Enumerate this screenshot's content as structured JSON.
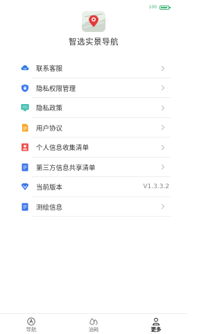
{
  "status_bar": {
    "battery_label": "100"
  },
  "app": {
    "title": "智选实景导航"
  },
  "menu": [
    {
      "label": "联系客服",
      "icon": "cloud-service-icon",
      "color": "#2f7be8"
    },
    {
      "label": "隐私权限管理",
      "icon": "shield-icon",
      "color": "#3b7cf0"
    },
    {
      "label": "隐私政策",
      "icon": "monitor-icon",
      "color": "#2bb6a6"
    },
    {
      "label": "用户协议",
      "icon": "document-icon",
      "color": "#f5a623"
    },
    {
      "label": "个人信息收集清单",
      "icon": "person-card-icon",
      "color": "#f05454"
    },
    {
      "label": "第三方信息共享清单",
      "icon": "list-document-icon",
      "color": "#3b74e6"
    },
    {
      "label": "当前版本",
      "icon": "version-v-icon",
      "color": "#3b74e6",
      "value": "V1.3.3.2"
    },
    {
      "label": "测绘信息",
      "icon": "info-document-icon",
      "color": "#3b74e6"
    }
  ],
  "tabs": [
    {
      "label": "导航",
      "icon": "compass-a-icon",
      "active": false
    },
    {
      "label": "油耗",
      "icon": "drops-icon",
      "active": false
    },
    {
      "label": "更多",
      "icon": "person-icon",
      "active": true
    }
  ]
}
